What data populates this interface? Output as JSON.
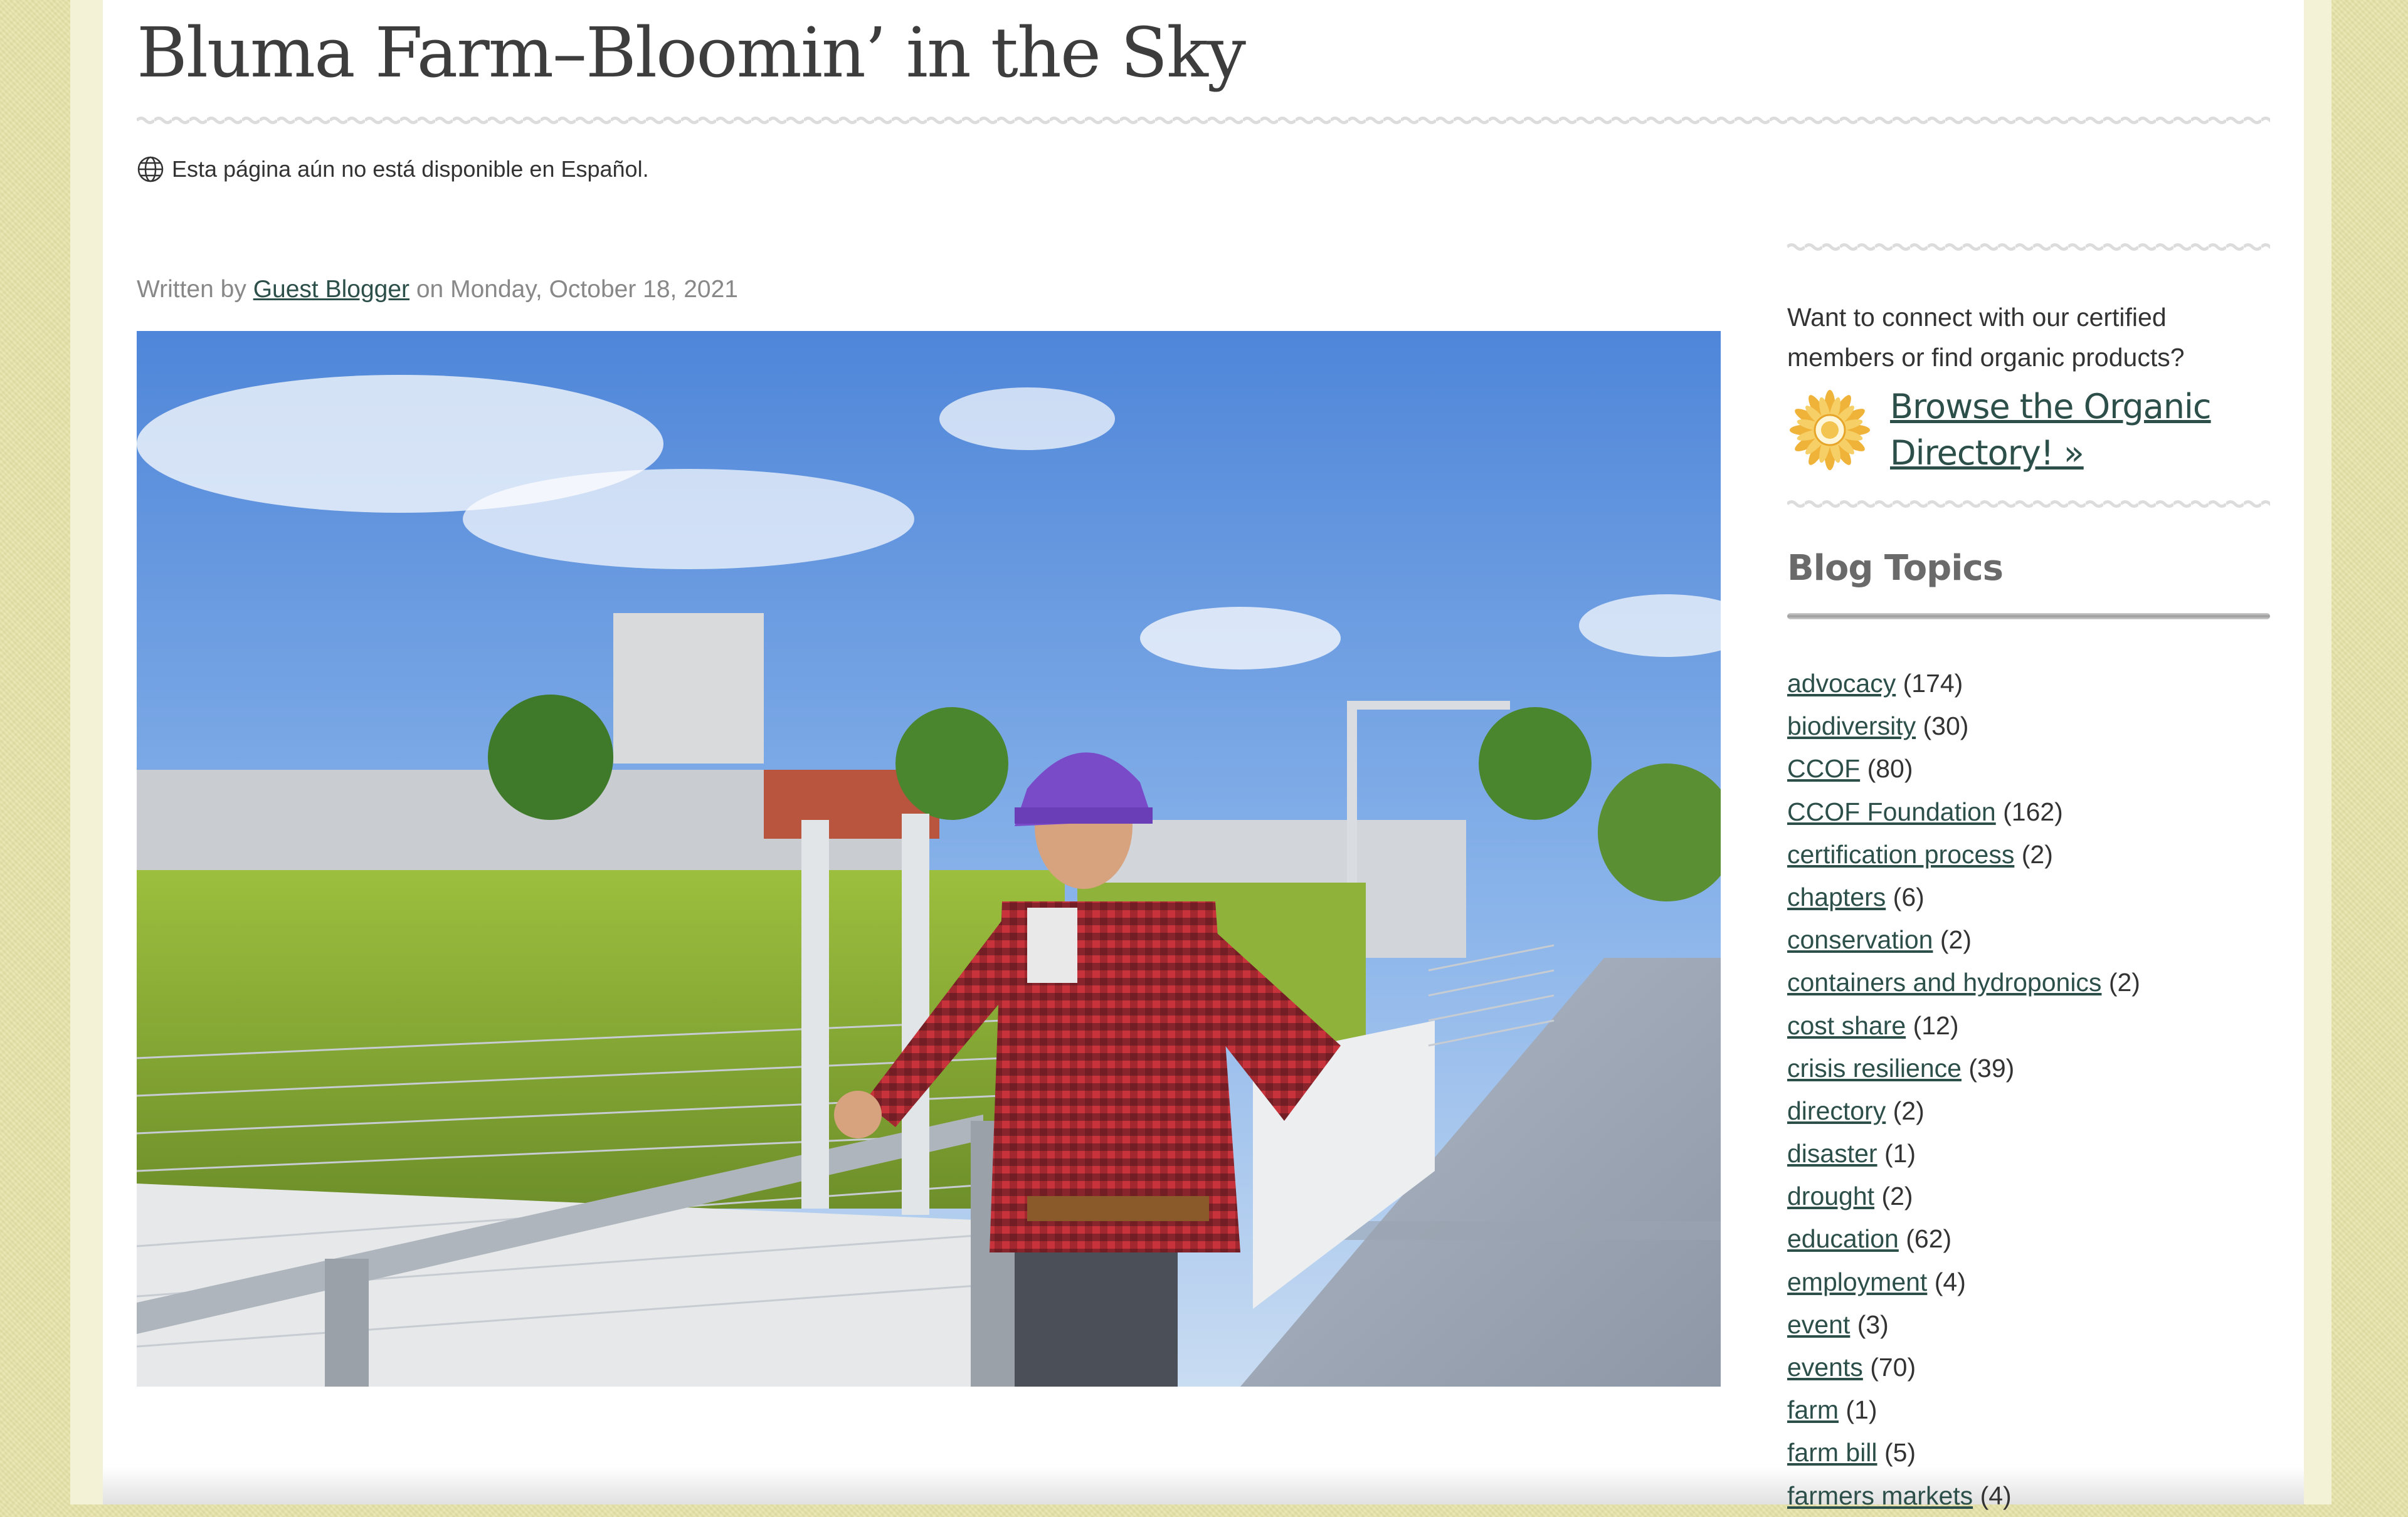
{
  "article": {
    "title": "Bluma Farm–Bloomin’ in the Sky",
    "language_notice": "Esta página aún no está disponible en Español.",
    "byline_prefix": "Written by",
    "author": "Guest Blogger",
    "byline_middle": "on",
    "date": "Monday, October 18, 2021",
    "hero_image_icon": "photo-of-farmer-on-rooftop-farm"
  },
  "sidebar": {
    "connect_text": "Want to connect with our certified members or find organic products?",
    "directory_icon": "sunflower-icon",
    "directory_link": "Browse the Organic Directory! »",
    "topics_heading": "Blog Topics",
    "topics": [
      {
        "label": "advocacy",
        "count": "(174)"
      },
      {
        "label": "biodiversity",
        "count": "(30)"
      },
      {
        "label": "CCOF",
        "count": "(80)"
      },
      {
        "label": "CCOF Foundation",
        "count": "(162)"
      },
      {
        "label": "certification process",
        "count": "(2)"
      },
      {
        "label": "chapters",
        "count": "(6)"
      },
      {
        "label": "conservation",
        "count": "(2)"
      },
      {
        "label": "containers and hydroponics",
        "count": "(2)"
      },
      {
        "label": "cost share",
        "count": "(12)"
      },
      {
        "label": "crisis resilience",
        "count": "(39)"
      },
      {
        "label": "directory",
        "count": "(2)"
      },
      {
        "label": "disaster",
        "count": "(1)"
      },
      {
        "label": "drought",
        "count": "(2)"
      },
      {
        "label": "education",
        "count": "(62)"
      },
      {
        "label": "employment",
        "count": "(4)"
      },
      {
        "label": "event",
        "count": "(3)"
      },
      {
        "label": "events",
        "count": "(70)"
      },
      {
        "label": "farm",
        "count": "(1)"
      },
      {
        "label": "farm bill",
        "count": "(5)"
      },
      {
        "label": "farmers markets",
        "count": "(4)"
      }
    ]
  },
  "colors": {
    "link": "#2c4f4a",
    "page_background": "#e8e3a8",
    "title": "#3d3d3d"
  }
}
